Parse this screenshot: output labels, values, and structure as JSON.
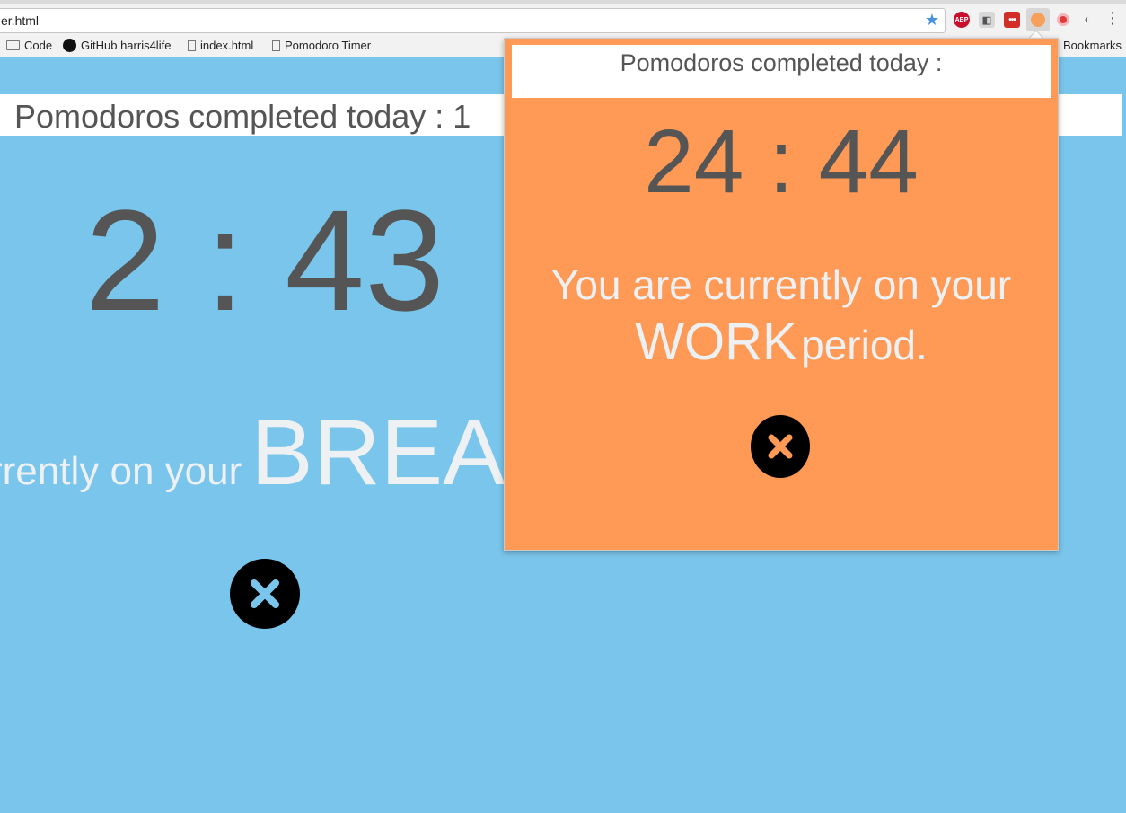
{
  "browser": {
    "url": "er.html",
    "bookmarks": [
      {
        "label": "Code",
        "icon": "folder-icon"
      },
      {
        "label": "GitHub harris4life",
        "icon": "github-icon"
      },
      {
        "label": "index.html",
        "icon": "page-icon"
      },
      {
        "label": "Pomodoro Timer",
        "icon": "page-icon"
      }
    ],
    "other_bookmarks": "Bookmarks",
    "extensions": {
      "abp": "ABP",
      "lastpass": "•••"
    }
  },
  "page": {
    "count_text": "Pomodoros completed today : 1",
    "timer": "2 : 43",
    "period_prefix": "rrently on your",
    "period_word": "BREA",
    "close_color": "#7ac5eb",
    "background": "#7ac5eb"
  },
  "popup": {
    "count_text": "Pomodoros completed today :",
    "timer": "24 : 44",
    "message_line1": "You are currently on your",
    "period_word": "WORK",
    "period_suffix": "period.",
    "close_color": "#ff9a56",
    "background": "#ff9a56"
  }
}
